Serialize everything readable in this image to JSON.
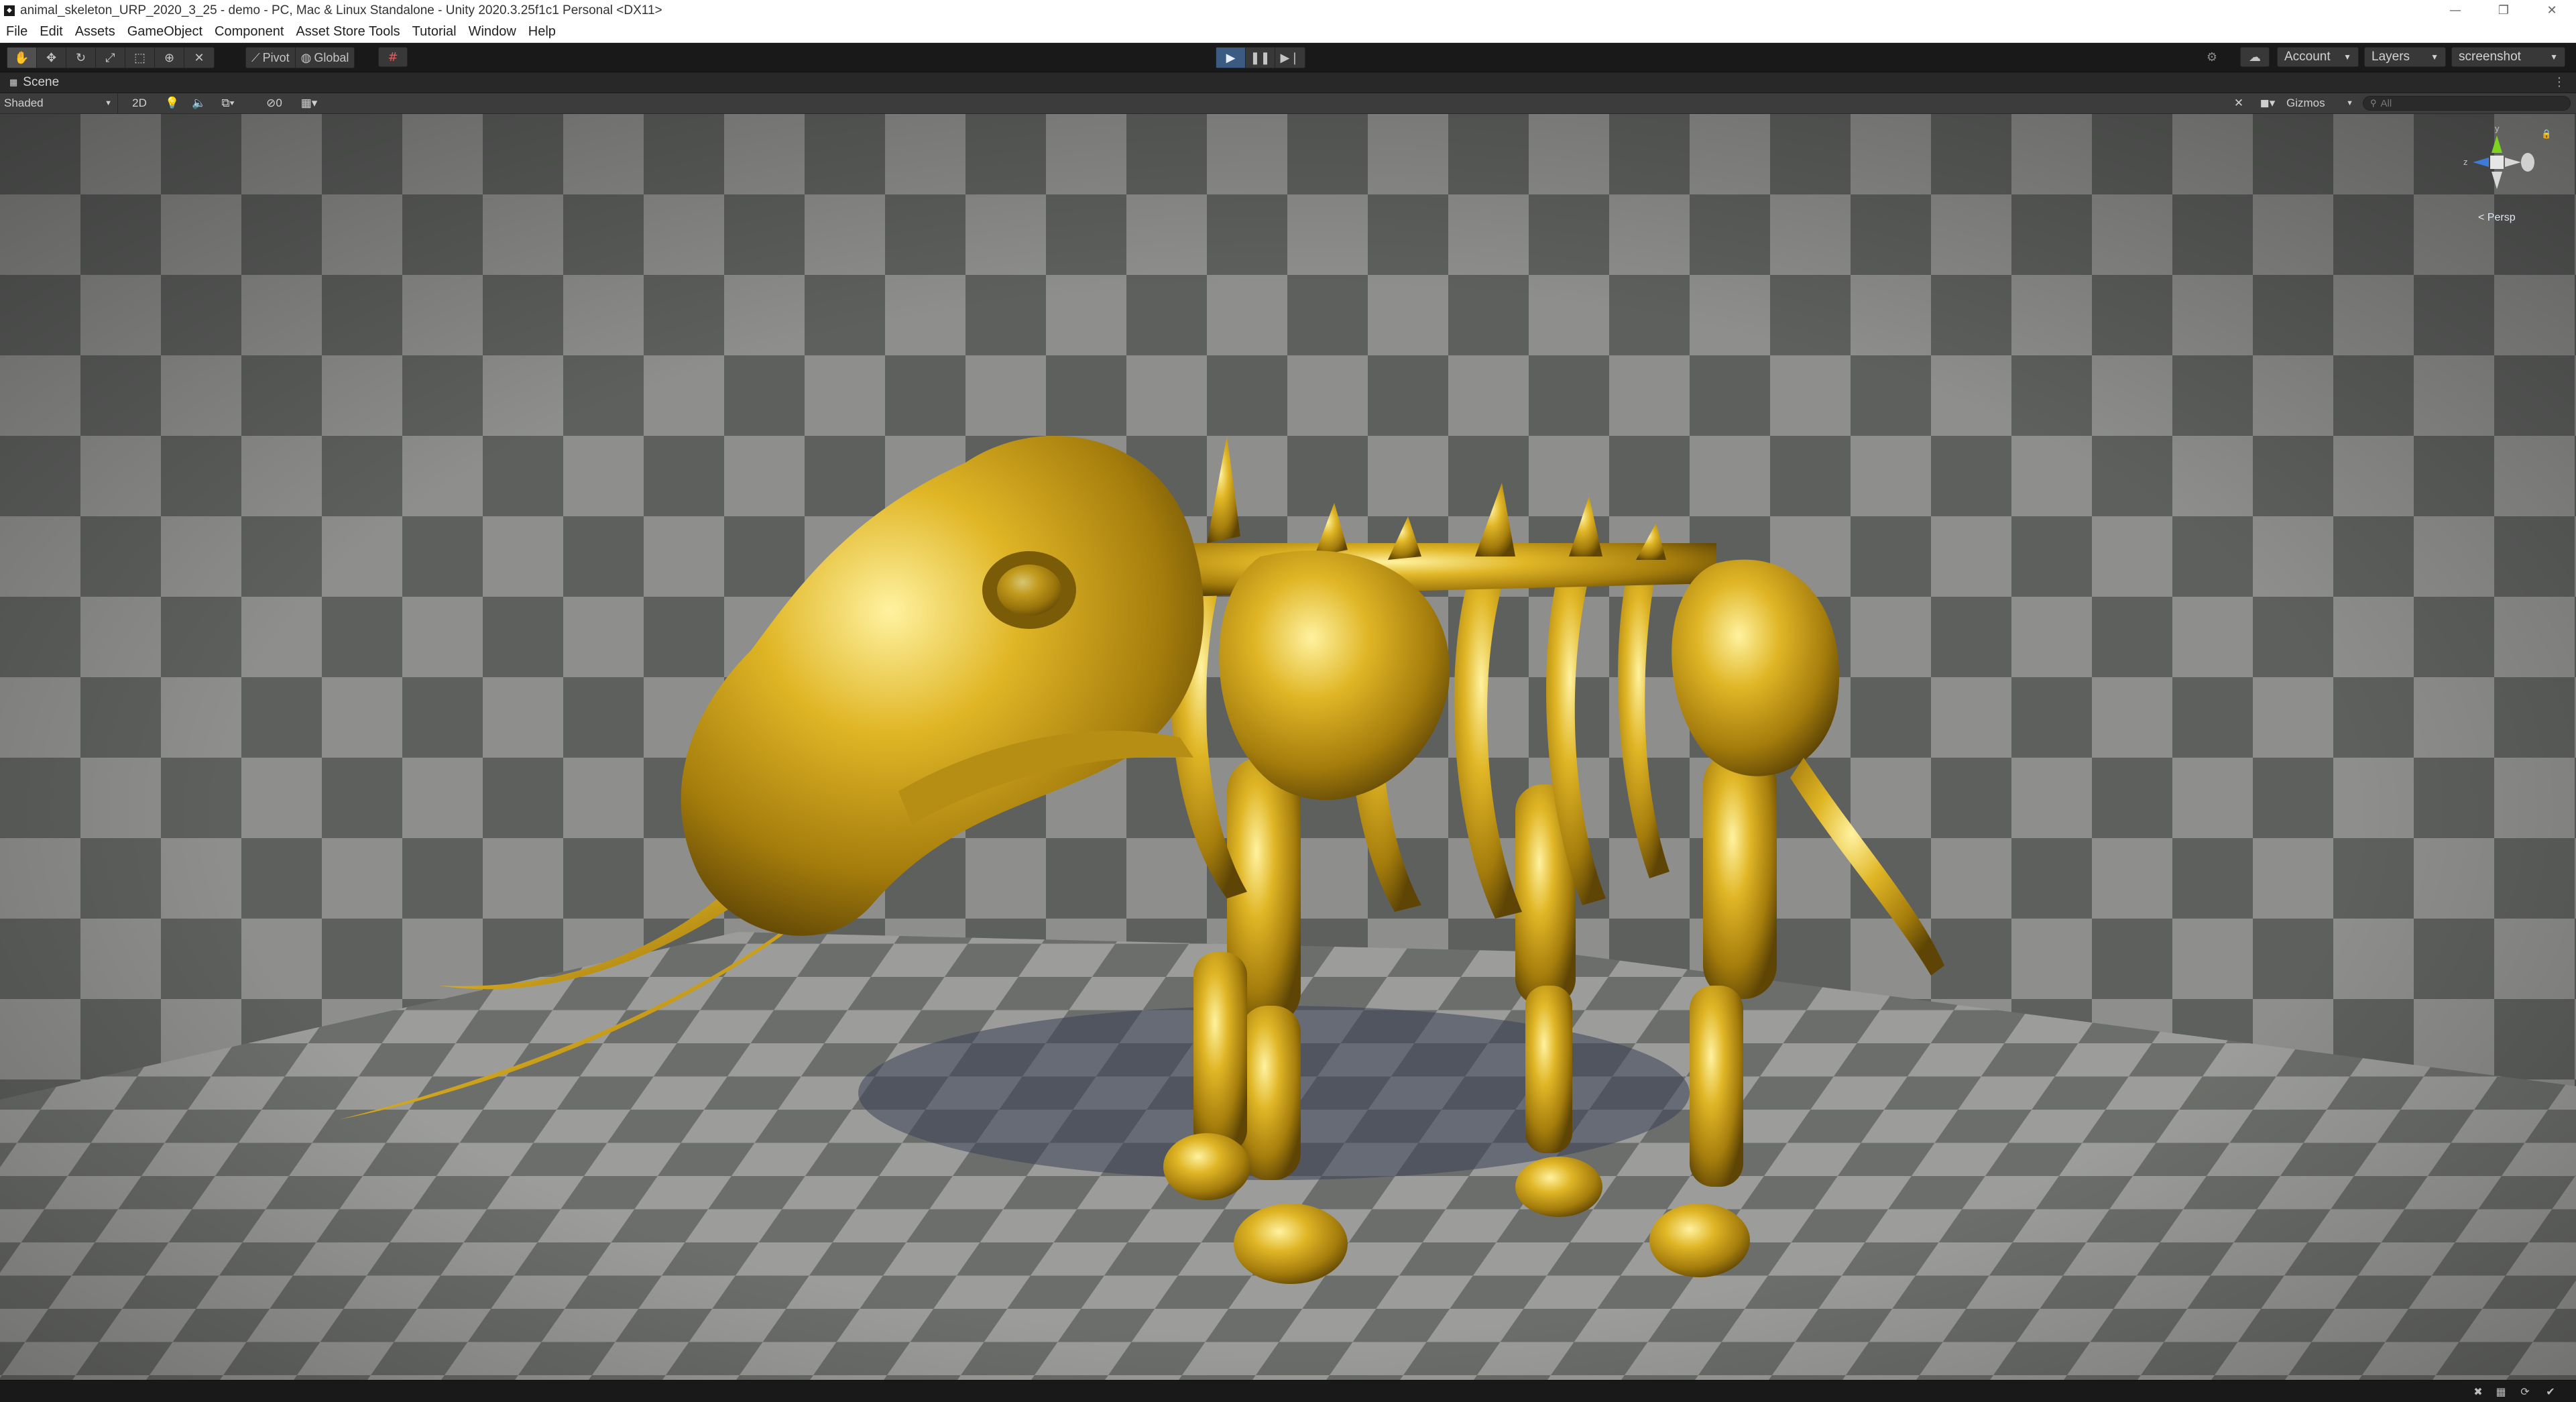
{
  "window": {
    "title": "animal_skeleton_URP_2020_3_25 - demo - PC, Mac & Linux Standalone - Unity 2020.3.25f1c1 Personal <DX11>",
    "minimize_icon": "minimize-icon",
    "maximize_icon": "restore-icon",
    "close_icon": "close-icon"
  },
  "menu": [
    "File",
    "Edit",
    "Assets",
    "GameObject",
    "Component",
    "Asset Store Tools",
    "Tutorial",
    "Window",
    "Help"
  ],
  "toolbar": {
    "tools": [
      "hand-tool-icon",
      "move-tool-icon",
      "rotate-tool-icon",
      "scale-tool-icon",
      "rect-tool-icon",
      "transform-tool-icon",
      "custom-tool-icon"
    ],
    "pivot_label": "Pivot",
    "global_label": "Global",
    "play_controls": [
      "play-icon",
      "pause-icon",
      "step-icon"
    ],
    "account_label": "Account",
    "layers_label": "Layers",
    "layout_label": "screenshot"
  },
  "scene": {
    "tab_label": "Scene",
    "shading_mode": "Shaded",
    "mode_2d": "2D",
    "hidden_count": "0",
    "gizmos_label": "Gizmos",
    "search_placeholder": "All",
    "persp_label": "< Persp",
    "axis_labels": {
      "y": "y",
      "z": "z"
    }
  },
  "colors": {
    "play_active": "#3c5b82",
    "gold": "#c9a018",
    "gizmo_y": "#7ed321",
    "gizmo_z": "#3d7bd9",
    "gizmo_x": "#d9d9d9"
  }
}
